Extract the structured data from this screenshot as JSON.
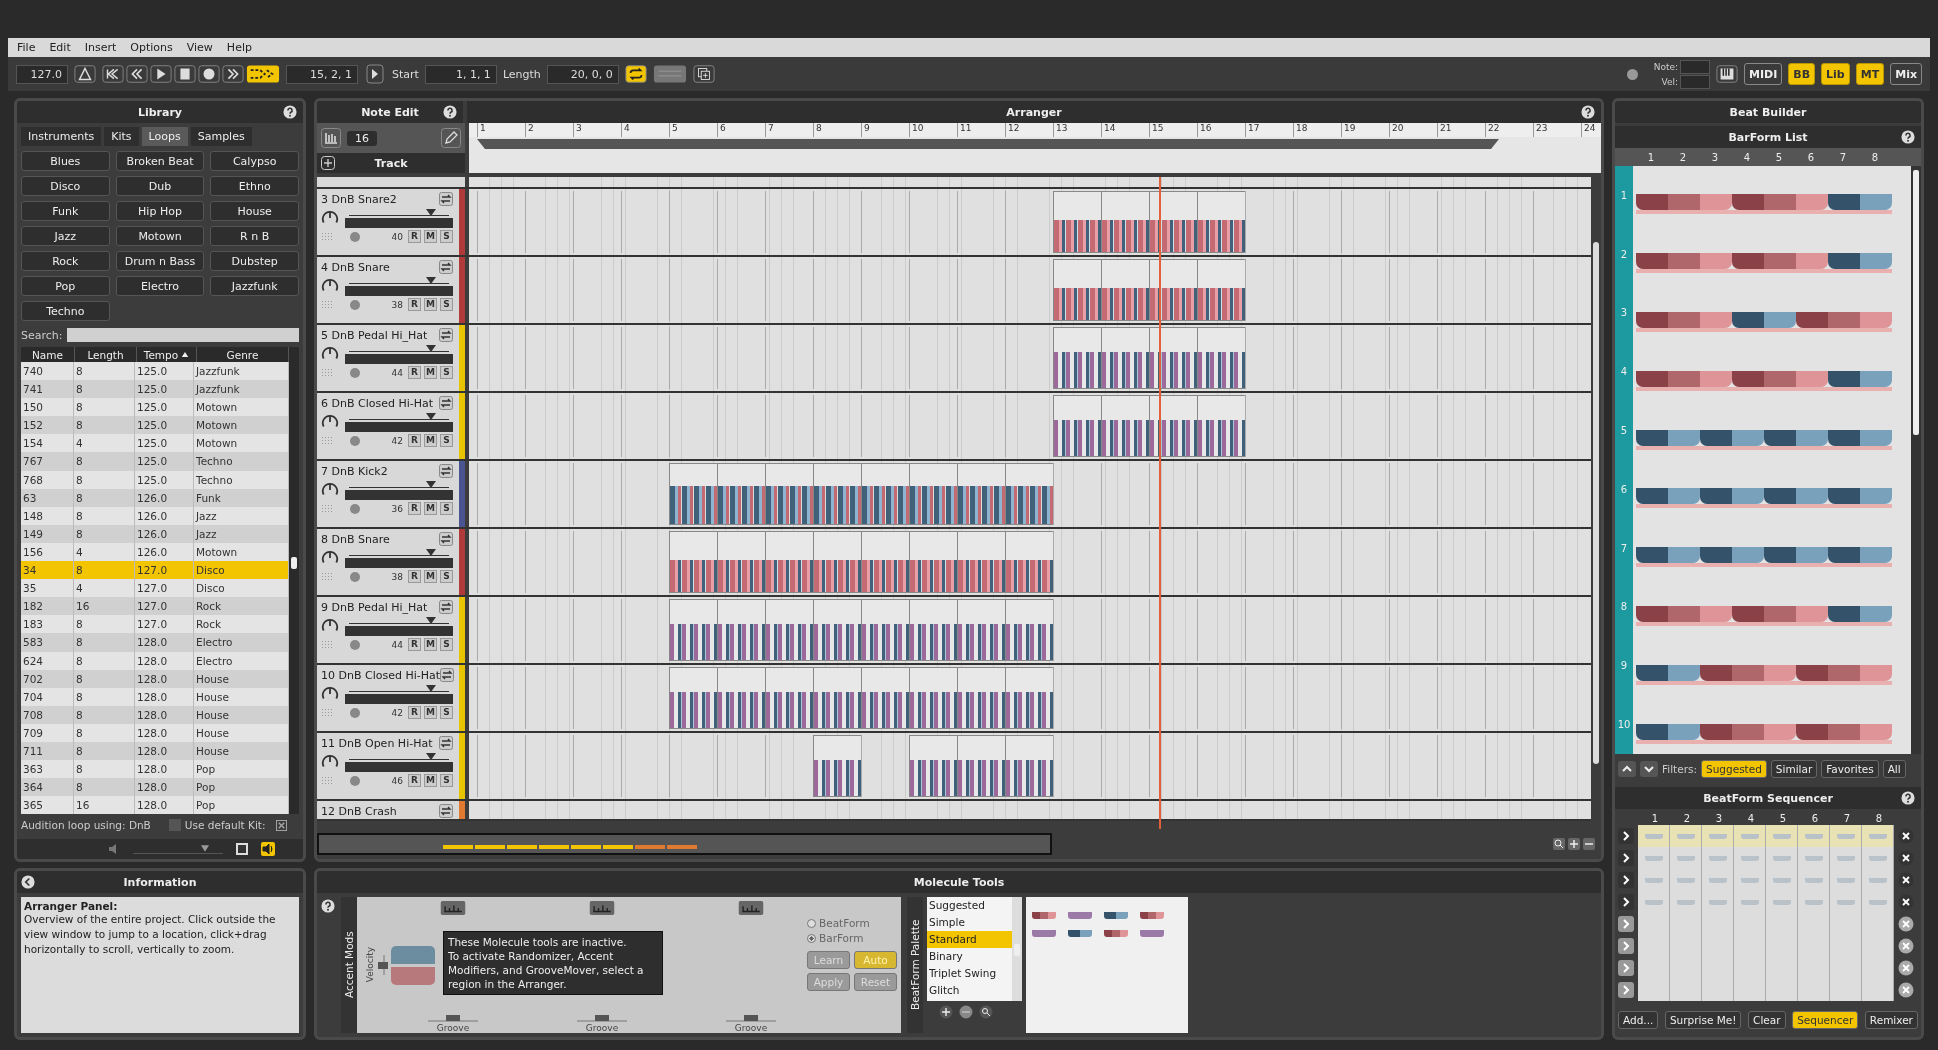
{
  "menu": [
    "File",
    "Edit",
    "Insert",
    "Options",
    "View",
    "Help"
  ],
  "toolbar": {
    "tempo": "127.0",
    "position": "15, 2, 1",
    "start_label": "Start",
    "start": "1, 1, 1",
    "length_label": "Length",
    "length": "20, 0, 0",
    "loop_on": true,
    "note_label": "Note:",
    "vel_label": "Vel:",
    "midi": "MIDI",
    "toggles": [
      {
        "label": "BB",
        "on": true
      },
      {
        "label": "Lib",
        "on": true
      },
      {
        "label": "MT",
        "on": true
      },
      {
        "label": "Mix",
        "on": false
      }
    ]
  },
  "library": {
    "title": "Library",
    "tabs": [
      {
        "label": "Instruments",
        "selected": false
      },
      {
        "label": "Kits",
        "selected": false
      },
      {
        "label": "Loops",
        "selected": true
      },
      {
        "label": "Samples",
        "selected": false
      }
    ],
    "genres": [
      "Blues",
      "Broken Beat",
      "Calypso",
      "Disco",
      "Dub",
      "Ethno",
      "Funk",
      "Hip Hop",
      "House",
      "Jazz",
      "Motown",
      "R n B",
      "Rock",
      "Drum n Bass",
      "Dubstep",
      "Pop",
      "Electro",
      "Jazzfunk",
      "Techno"
    ],
    "search_label": "Search:",
    "columns": [
      "Name",
      "Length",
      "Tempo",
      "Genre"
    ],
    "rows": [
      {
        "cells": [
          "740",
          "8",
          "125.0",
          "Jazzfunk"
        ],
        "selected": false
      },
      {
        "cells": [
          "741",
          "8",
          "125.0",
          "Jazzfunk"
        ],
        "selected": false
      },
      {
        "cells": [
          "150",
          "8",
          "125.0",
          "Motown"
        ],
        "selected": false
      },
      {
        "cells": [
          "152",
          "8",
          "125.0",
          "Motown"
        ],
        "selected": false
      },
      {
        "cells": [
          "154",
          "4",
          "125.0",
          "Motown"
        ],
        "selected": false
      },
      {
        "cells": [
          "767",
          "8",
          "125.0",
          "Techno"
        ],
        "selected": false
      },
      {
        "cells": [
          "768",
          "8",
          "125.0",
          "Techno"
        ],
        "selected": false
      },
      {
        "cells": [
          "63",
          "8",
          "126.0",
          "Funk"
        ],
        "selected": false
      },
      {
        "cells": [
          "148",
          "8",
          "126.0",
          "Jazz"
        ],
        "selected": false
      },
      {
        "cells": [
          "149",
          "8",
          "126.0",
          "Jazz"
        ],
        "selected": false
      },
      {
        "cells": [
          "156",
          "4",
          "126.0",
          "Motown"
        ],
        "selected": false
      },
      {
        "cells": [
          "34",
          "8",
          "127.0",
          "Disco"
        ],
        "selected": true
      },
      {
        "cells": [
          "35",
          "4",
          "127.0",
          "Disco"
        ],
        "selected": false
      },
      {
        "cells": [
          "182",
          "16",
          "127.0",
          "Rock"
        ],
        "selected": false
      },
      {
        "cells": [
          "183",
          "8",
          "127.0",
          "Rock"
        ],
        "selected": false
      },
      {
        "cells": [
          "583",
          "8",
          "128.0",
          "Electro"
        ],
        "selected": false
      },
      {
        "cells": [
          "624",
          "8",
          "128.0",
          "Electro"
        ],
        "selected": false
      },
      {
        "cells": [
          "702",
          "8",
          "128.0",
          "House"
        ],
        "selected": false
      },
      {
        "cells": [
          "704",
          "8",
          "128.0",
          "House"
        ],
        "selected": false
      },
      {
        "cells": [
          "708",
          "8",
          "128.0",
          "House"
        ],
        "selected": false
      },
      {
        "cells": [
          "709",
          "8",
          "128.0",
          "House"
        ],
        "selected": false
      },
      {
        "cells": [
          "711",
          "8",
          "128.0",
          "House"
        ],
        "selected": false
      },
      {
        "cells": [
          "363",
          "8",
          "128.0",
          "Pop"
        ],
        "selected": false
      },
      {
        "cells": [
          "364",
          "8",
          "128.0",
          "Pop"
        ],
        "selected": false
      },
      {
        "cells": [
          "365",
          "16",
          "128.0",
          "Pop"
        ],
        "selected": false
      }
    ],
    "audition": "Audition loop using: DnB",
    "default_kit": "Use default Kit:",
    "default_kit_checked": false,
    "volume": {
      "level": 0.8
    }
  },
  "note_edit": {
    "title": "Note Edit",
    "grid": "16",
    "track_header": "Track"
  },
  "arranger": {
    "title": "Arranger",
    "bars": [
      "1",
      "2",
      "3",
      "4",
      "5",
      "6",
      "7",
      "8",
      "9",
      "10",
      "11",
      "12",
      "13",
      "14",
      "15",
      "16",
      "17",
      "18",
      "19",
      "20",
      "21",
      "22",
      "23",
      "24"
    ],
    "tracks": [
      {
        "label": "3 DnB Snare2",
        "note": "40",
        "level": 0.8,
        "color": "#b03a3a",
        "rms": [
          "R",
          "M",
          "S"
        ],
        "filled_bars": [
          false,
          false,
          false,
          false,
          false,
          false,
          false,
          false,
          false,
          false,
          false,
          false,
          true,
          true,
          true,
          true,
          false,
          false,
          false,
          false,
          false,
          false,
          false
        ]
      },
      {
        "label": "4 DnB Snare",
        "note": "38",
        "level": 0.8,
        "color": "#b03a3a",
        "rms": [
          "R",
          "M",
          "S"
        ],
        "filled_bars": [
          false,
          false,
          false,
          false,
          false,
          false,
          false,
          false,
          false,
          false,
          false,
          false,
          true,
          true,
          true,
          true,
          false,
          false,
          false,
          false,
          false,
          false,
          false
        ]
      },
      {
        "label": "5 DnB Pedal Hi_Hat",
        "note": "44",
        "level": 0.8,
        "color": "#e8c400",
        "rms": [
          "R",
          "M",
          "S"
        ],
        "filled_bars": [
          false,
          false,
          false,
          false,
          false,
          false,
          false,
          false,
          false,
          false,
          false,
          false,
          true,
          true,
          true,
          true,
          false,
          false,
          false,
          false,
          false,
          false,
          false
        ]
      },
      {
        "label": "6 DnB Closed Hi-Hat",
        "note": "42",
        "level": 0.8,
        "color": "#e8c400",
        "rms": [
          "R",
          "M",
          "S"
        ],
        "filled_bars": [
          false,
          false,
          false,
          false,
          false,
          false,
          false,
          false,
          false,
          false,
          false,
          false,
          true,
          true,
          true,
          true,
          false,
          false,
          false,
          false,
          false,
          false,
          false
        ]
      },
      {
        "label": "7 DnB Kick2",
        "note": "36",
        "level": 0.8,
        "color": "#4a5490",
        "rms": [
          "R",
          "M",
          "S"
        ],
        "filled_bars": [
          false,
          false,
          false,
          false,
          true,
          true,
          true,
          true,
          true,
          true,
          true,
          true,
          false,
          false,
          false,
          false,
          false,
          false,
          false,
          false,
          false,
          false,
          false
        ]
      },
      {
        "label": "8 DnB Snare",
        "note": "38",
        "level": 0.8,
        "color": "#b03a3a",
        "rms": [
          "R",
          "M",
          "S"
        ],
        "filled_bars": [
          false,
          false,
          false,
          false,
          true,
          true,
          true,
          true,
          true,
          true,
          true,
          true,
          false,
          false,
          false,
          false,
          false,
          false,
          false,
          false,
          false,
          false,
          false
        ]
      },
      {
        "label": "9 DnB Pedal Hi_Hat",
        "note": "44",
        "level": 0.8,
        "color": "#e8c400",
        "rms": [
          "R",
          "M",
          "S"
        ],
        "filled_bars": [
          false,
          false,
          false,
          false,
          true,
          true,
          true,
          true,
          true,
          true,
          true,
          true,
          false,
          false,
          false,
          false,
          false,
          false,
          false,
          false,
          false,
          false,
          false
        ]
      },
      {
        "label": "10 DnB Closed Hi-Hat",
        "note": "42",
        "level": 0.8,
        "color": "#e8c400",
        "rms": [
          "R",
          "M",
          "S"
        ],
        "filled_bars": [
          false,
          false,
          false,
          false,
          true,
          true,
          true,
          true,
          true,
          true,
          true,
          true,
          false,
          false,
          false,
          false,
          false,
          false,
          false,
          false,
          false,
          false,
          false
        ]
      },
      {
        "label": "11 DnB Open Hi-Hat",
        "note": "46",
        "level": 0.8,
        "color": "#e8c400",
        "rms": [
          "R",
          "M",
          "S"
        ],
        "filled_bars": [
          false,
          false,
          false,
          false,
          false,
          false,
          false,
          true,
          false,
          true,
          true,
          true,
          false,
          false,
          false,
          false,
          false,
          false,
          false,
          false,
          false,
          false,
          false
        ]
      }
    ],
    "last_track": {
      "label": "12 DnB Crash",
      "color": "#e07a30"
    }
  },
  "info": {
    "title": "Information",
    "heading": "Arranger Panel:",
    "text": "Overview of the entire project. Click outside the view window to jump to a location, click+drag horizontally to scroll, vertically to zoom."
  },
  "molecule": {
    "title": "Molecule Tools",
    "accent_label": "Accent Mods",
    "velocity_label": "Velocity",
    "grooves": [
      "Groove",
      "Groove",
      "Groove"
    ],
    "notice": "These Molecule tools are inactive.\nTo activate Randomizer, Accent Modifiers, and GrooveMover, select a region in the Arranger.",
    "radios": [
      {
        "label": "BeatForm",
        "selected": false
      },
      {
        "label": "BarForm",
        "selected": true
      }
    ],
    "buttons": [
      {
        "label": "Learn",
        "active": false
      },
      {
        "label": "Auto",
        "active": true
      },
      {
        "label": "Apply",
        "active": false
      },
      {
        "label": "Reset",
        "active": false
      }
    ],
    "palette_label": "BeatForm Palette",
    "palette": [
      {
        "label": "Suggested",
        "selected": false
      },
      {
        "label": "Simple",
        "selected": false
      },
      {
        "label": "Standard",
        "selected": true
      },
      {
        "label": "Binary",
        "selected": false
      },
      {
        "label": "Triplet Swing",
        "selected": false
      },
      {
        "label": "Glitch",
        "selected": false
      }
    ]
  },
  "beat_builder": {
    "title": "Beat Builder",
    "list_title": "BarForm List",
    "columns": [
      "1",
      "2",
      "3",
      "4",
      "5",
      "6",
      "7",
      "8"
    ],
    "barforms": [
      {
        "label": "1",
        "groups": [
          {
            "kind": "triple"
          },
          {
            "kind": "triple"
          },
          {
            "kind": "duple"
          }
        ]
      },
      {
        "label": "2",
        "groups": [
          {
            "kind": "triple"
          },
          {
            "kind": "triple"
          },
          {
            "kind": "duple"
          }
        ]
      },
      {
        "label": "3",
        "groups": [
          {
            "kind": "triple"
          },
          {
            "kind": "duple"
          },
          {
            "kind": "triple"
          }
        ]
      },
      {
        "label": "4",
        "groups": [
          {
            "kind": "triple"
          },
          {
            "kind": "triple"
          },
          {
            "kind": "duple"
          }
        ]
      },
      {
        "label": "5",
        "groups": [
          {
            "kind": "duple"
          },
          {
            "kind": "duple"
          },
          {
            "kind": "duple"
          },
          {
            "kind": "duple"
          }
        ]
      },
      {
        "label": "6",
        "groups": [
          {
            "kind": "duple"
          },
          {
            "kind": "duple"
          },
          {
            "kind": "duple"
          },
          {
            "kind": "duple"
          }
        ]
      },
      {
        "label": "7",
        "groups": [
          {
            "kind": "duple"
          },
          {
            "kind": "duple"
          },
          {
            "kind": "duple"
          },
          {
            "kind": "duple"
          }
        ]
      },
      {
        "label": "8",
        "groups": [
          {
            "kind": "triple"
          },
          {
            "kind": "triple"
          },
          {
            "kind": "duple"
          }
        ]
      },
      {
        "label": "9",
        "groups": [
          {
            "kind": "duple"
          },
          {
            "kind": "triple"
          },
          {
            "kind": "triple"
          }
        ]
      },
      {
        "label": "10",
        "groups": [
          {
            "kind": "duple"
          },
          {
            "kind": "triple"
          },
          {
            "kind": "triple"
          }
        ]
      }
    ],
    "filters_label": "Filters:",
    "filters": [
      {
        "label": "Suggested",
        "selected": true
      },
      {
        "label": "Similar",
        "selected": false
      },
      {
        "label": "Favorites",
        "selected": false
      },
      {
        "label": "All",
        "selected": false
      }
    ],
    "sequencer_title": "BeatForm Sequencer",
    "seq_columns": [
      "1",
      "2",
      "3",
      "4",
      "5",
      "6",
      "7",
      "8"
    ],
    "seq_rows": [
      {
        "disabled": false
      },
      {
        "disabled": false
      },
      {
        "disabled": false
      },
      {
        "disabled": false
      },
      {
        "disabled": true
      },
      {
        "disabled": true
      },
      {
        "disabled": true
      },
      {
        "disabled": true
      }
    ],
    "actions": [
      {
        "label": "Add...",
        "selected": false
      },
      {
        "label": "Surprise Me!",
        "selected": false
      },
      {
        "label": "Clear",
        "selected": false
      },
      {
        "label": "Sequencer",
        "selected": true
      },
      {
        "label": "Remixer",
        "selected": false
      }
    ]
  }
}
